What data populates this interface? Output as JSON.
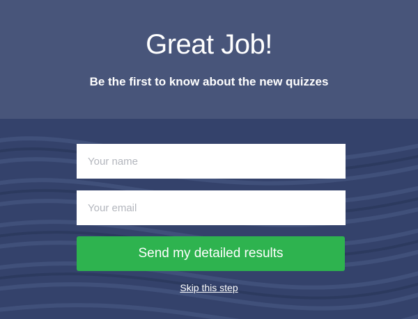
{
  "header": {
    "title": "Great Job!",
    "subtitle": "Be the first to know about the new quizzes"
  },
  "form": {
    "name_placeholder": "Your name",
    "email_placeholder": "Your email",
    "name_value": "",
    "email_value": "",
    "submit_label": "Send my detailed results",
    "skip_label": "Skip this step"
  },
  "colors": {
    "header_bg": "#48557a",
    "page_bg": "#34426b",
    "button_green": "#2eb34f"
  }
}
